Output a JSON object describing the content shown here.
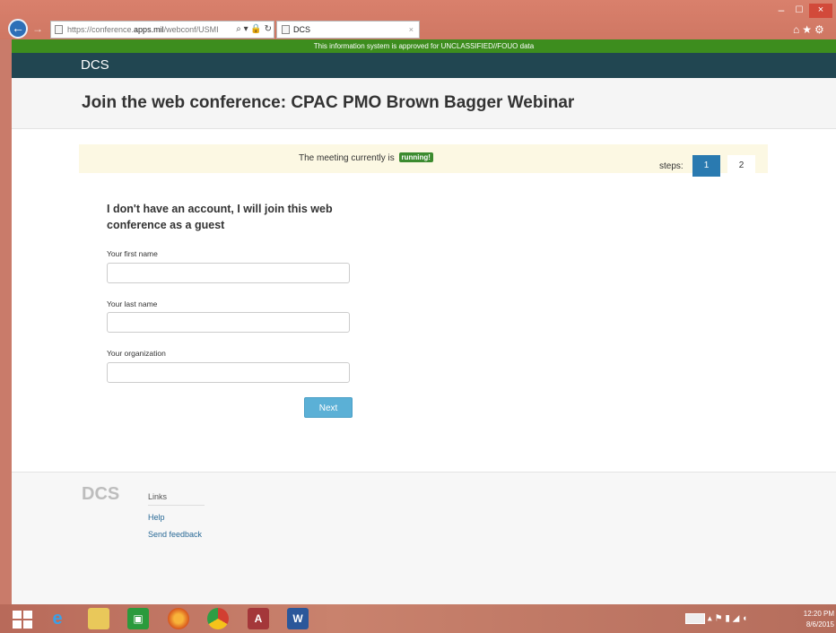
{
  "browser": {
    "url_prefix": "https://conference.",
    "url_host": "apps.mil",
    "url_suffix": "/webconf/USMI",
    "url_tools": "⌕ ▾ 🔒 ↻",
    "tab_title": "DCS",
    "tab_close": "×",
    "min_glyph": "–",
    "max_glyph": "☐",
    "close_glyph": "×",
    "right_icons": "⌂★⚙"
  },
  "page": {
    "classification_banner": "This information system is approved for UNCLASSIFIED//FOUO data",
    "brand": "DCS",
    "title": "Join the web conference: CPAC PMO Brown Bagger Webinar",
    "status_prefix": "The meeting currently is",
    "status_badge": "running!",
    "steps_label": "steps:",
    "steps": [
      "1",
      "2"
    ],
    "guest_heading": "I don't have an account, I will join this web conference as a guest",
    "fields": {
      "first_name": {
        "label": "Your first name",
        "value": ""
      },
      "last_name": {
        "label": "Your last name",
        "value": ""
      },
      "organization": {
        "label": "Your organization",
        "value": ""
      }
    },
    "next_label": "Next",
    "footer": {
      "logo": "DCS",
      "links_title": "Links",
      "links": [
        "Help",
        "Send feedback"
      ]
    }
  },
  "taskbar": {
    "apps": [
      "internet-explorer",
      "file-explorer",
      "store",
      "firefox",
      "chrome",
      "access",
      "word"
    ],
    "app_letters": {
      "ie": "e",
      "store": "▣",
      "access": "A",
      "word": "W"
    },
    "tray_icons": "▴ ⚑ ▮ ◢ ◖",
    "clock_time": "12:20 PM",
    "clock_date": "8/6/2015"
  },
  "colors": {
    "navbar": "#214651",
    "classification": "#3d8d1e",
    "step_active": "#2a7ab0",
    "next_button": "#5bb0d6",
    "status_bg": "#fcf8e3"
  }
}
